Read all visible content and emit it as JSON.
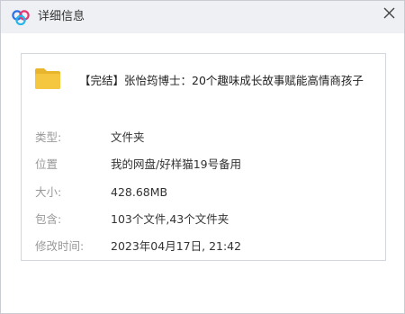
{
  "window": {
    "title": "详细信息",
    "icons": {
      "app": "baidu-netdisk-cloud-logo",
      "close": "close-icon"
    }
  },
  "file": {
    "name": "【完结】张怡筠博士：20个趣味成长故事赋能高情商孩子",
    "icon": "folder-icon",
    "icon_color": "#f5c640",
    "details": [
      {
        "label": "类型:",
        "value": "文件夹"
      },
      {
        "label": "位置",
        "value": "我的网盘/好样猫19号备用"
      },
      {
        "label": "大小:",
        "value": "428.68MB"
      },
      {
        "label": "包含:",
        "value": "103个文件,43个文件夹"
      },
      {
        "label": "修改时间:",
        "value": "2023年04月17日, 21:42"
      }
    ]
  },
  "colors": {
    "titlebar_bg": "#eef0f4",
    "label_text": "#999999",
    "value_text": "#333333",
    "logo_blue": "#2f6fe4",
    "logo_pink": "#e8356f",
    "logo_teal": "#23b6e9"
  }
}
